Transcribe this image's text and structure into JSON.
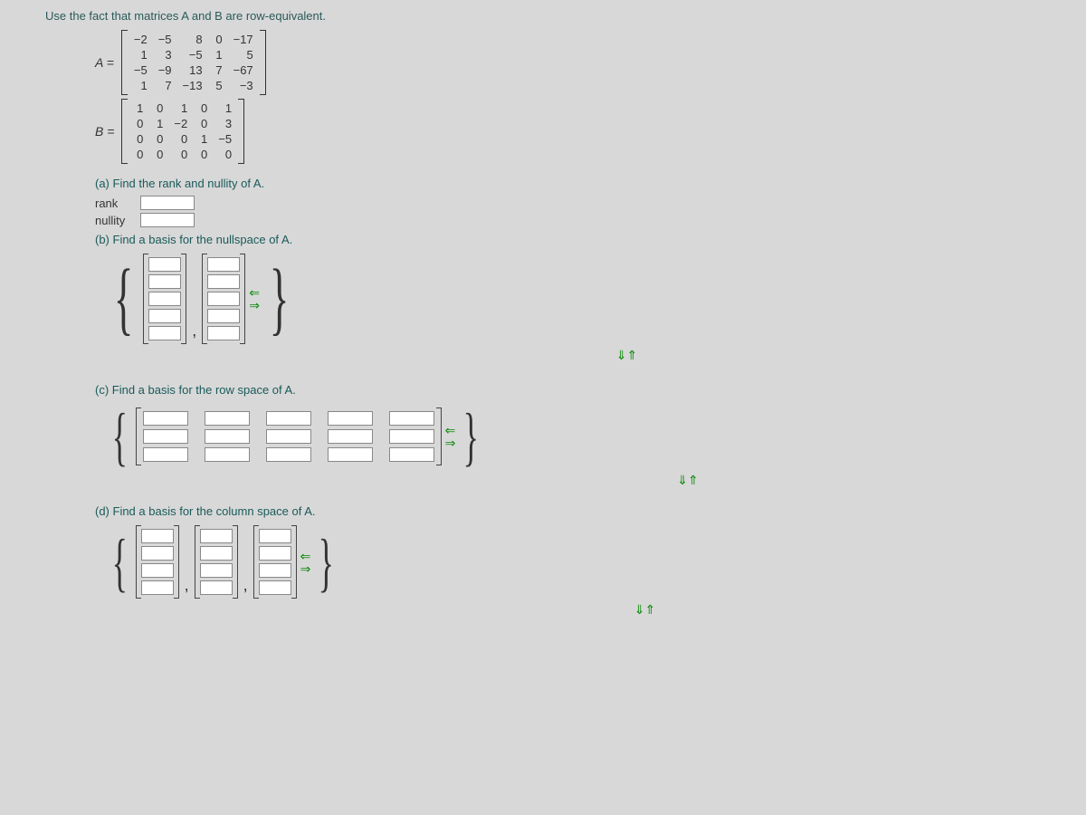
{
  "instruction": "Use the fact that matrices A and B are row-equivalent.",
  "matrixA": {
    "label": "A =",
    "rows": [
      [
        "−2",
        "−5",
        "8",
        "0",
        "−17"
      ],
      [
        "1",
        "3",
        "−5",
        "1",
        "5"
      ],
      [
        "−5",
        "−9",
        "13",
        "7",
        "−67"
      ],
      [
        "1",
        "7",
        "−13",
        "5",
        "−3"
      ]
    ]
  },
  "matrixB": {
    "label": "B =",
    "rows": [
      [
        "1",
        "0",
        "1",
        "0",
        "1"
      ],
      [
        "0",
        "1",
        "−2",
        "0",
        "3"
      ],
      [
        "0",
        "0",
        "0",
        "1",
        "−5"
      ],
      [
        "0",
        "0",
        "0",
        "0",
        "0"
      ]
    ]
  },
  "partA": {
    "text": "(a) Find the rank and nullity of A.",
    "rank_label": "rank",
    "nullity_label": "nullity"
  },
  "partB": {
    "text": "(b) Find a basis for the nullspace of A."
  },
  "partC": {
    "text": "(c) Find a basis for the row space of A."
  },
  "partD": {
    "text": "(d) Find a basis for the column space of A."
  },
  "braces": {
    "left": "{",
    "right": "}"
  },
  "arrows": {
    "left": "⇐",
    "right": "⇒",
    "down": "⇓",
    "up": "⇑"
  }
}
